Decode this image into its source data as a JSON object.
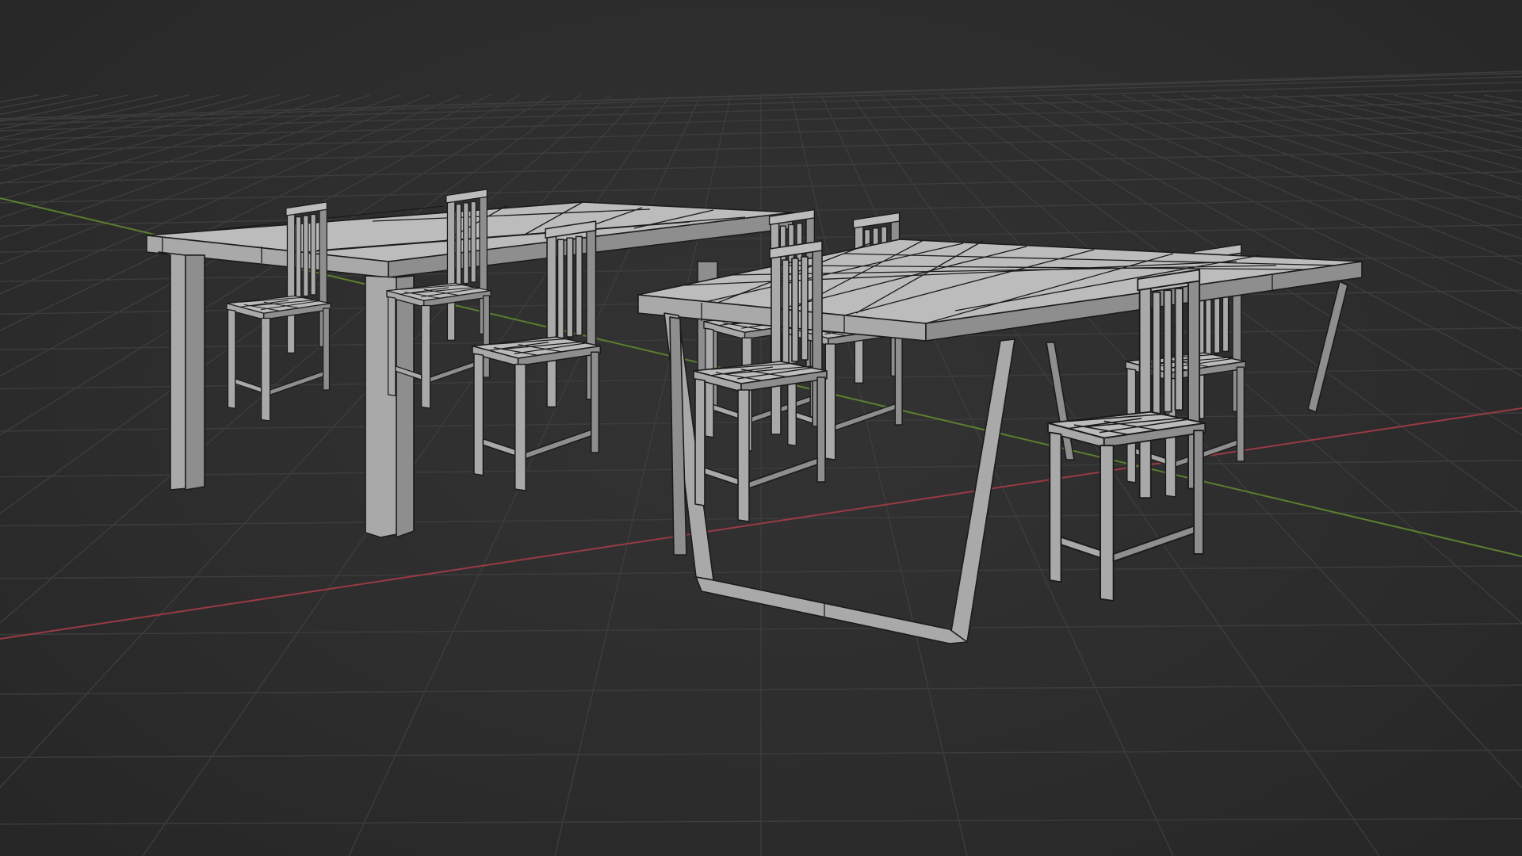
{
  "app": {
    "name": "",
    "view": "3D Viewport"
  },
  "colors": {
    "background": "#2b2b2b",
    "grid": "#3d3d3d",
    "x_axis": "#9a3a44",
    "y_axis": "#5b7f2e",
    "mesh": "#a9a9a9",
    "mesh_wire": "#1b1b1b"
  },
  "scene": {
    "shading": "solid",
    "overlays": {
      "floor_grid": true,
      "x_axis_line": true,
      "y_axis_line": true
    },
    "objects": [
      {
        "id": "table-left",
        "type": "dining table",
        "style": "straight legs"
      },
      {
        "id": "table-right",
        "type": "dining table",
        "style": "trapezoid frame legs"
      },
      {
        "id": "chair-1",
        "type": "chair"
      },
      {
        "id": "chair-2",
        "type": "chair"
      },
      {
        "id": "chair-3",
        "type": "chair"
      },
      {
        "id": "chair-4",
        "type": "chair"
      },
      {
        "id": "chair-5",
        "type": "chair"
      },
      {
        "id": "chair-6",
        "type": "chair"
      },
      {
        "id": "chair-7",
        "type": "chair"
      },
      {
        "id": "chair-8",
        "type": "chair"
      }
    ]
  }
}
